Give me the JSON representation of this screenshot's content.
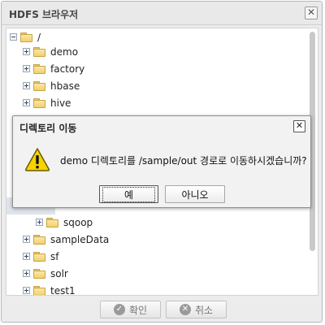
{
  "window": {
    "title": "HDFS 브라우저",
    "close_glyph": "✕"
  },
  "tree": {
    "root": {
      "label": "/"
    },
    "items_top": [
      {
        "label": "demo"
      },
      {
        "label": "factory"
      },
      {
        "label": "hbase"
      },
      {
        "label": "hive"
      }
    ],
    "sub_item": {
      "label": "sqoop"
    },
    "items_bottom": [
      {
        "label": "sampleData"
      },
      {
        "label": "sf"
      },
      {
        "label": "solr"
      },
      {
        "label": "test1"
      }
    ]
  },
  "footer": {
    "confirm_label": "확인",
    "confirm_glyph": "✓",
    "cancel_label": "취소",
    "cancel_glyph": "✕"
  },
  "dialog": {
    "title": "디렉토리 이동",
    "close_glyph": "✕",
    "message": "demo 디렉토리를 /sample/out 경로로 이동하시겠습니까?",
    "yes_label": "예",
    "no_label": "아니오"
  }
}
